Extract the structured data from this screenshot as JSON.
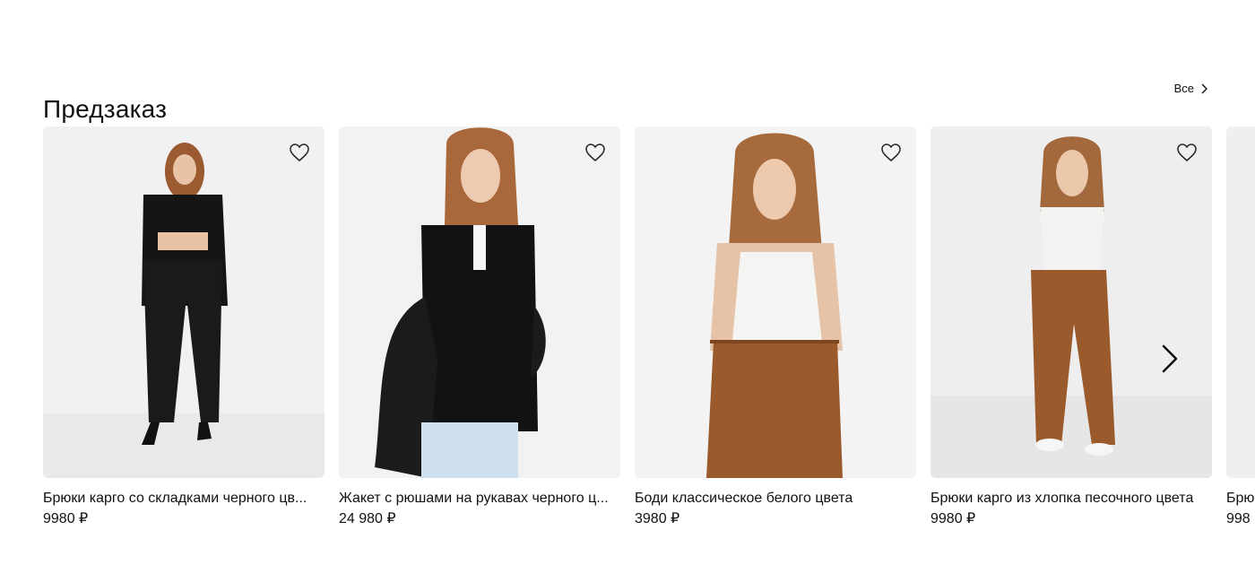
{
  "section": {
    "title": "Предзаказ",
    "all_link": "Все"
  },
  "products": [
    {
      "title": "Брюки карго со складками черного цв...",
      "price": "9980 ₽",
      "image": "model-black-cargo-outfit"
    },
    {
      "title": "Жакет с рюшами на рукавах черного ц...",
      "price": "24 980 ₽",
      "image": "model-black-ruffle-jacket"
    },
    {
      "title": "Боди классическое белого цвета",
      "price": "3980 ₽",
      "image": "model-white-bodysuit"
    },
    {
      "title": "Брюки карго из хлопка песочного цвета",
      "price": "9980 ₽",
      "image": "model-sand-cargo-pants"
    },
    {
      "title": "Брюк",
      "price": "998",
      "image": "partial-card"
    }
  ],
  "icons": {
    "favorite": "heart-outline-icon",
    "next": "chevron-right-icon",
    "all_arrow": "chevron-right-icon"
  },
  "colors": {
    "text": "#111111",
    "photo_bg": "#efefef",
    "brown": "#9a5a2c",
    "black_cloth": "#161616"
  }
}
